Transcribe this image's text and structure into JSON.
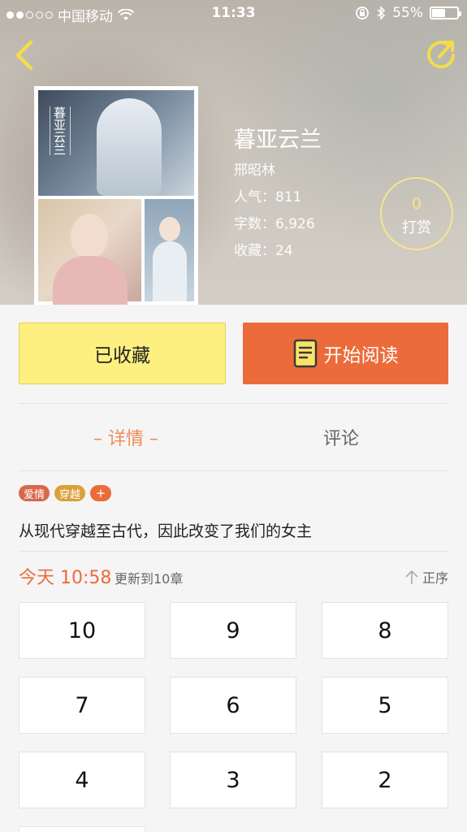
{
  "status_bar": {
    "carrier": "中国移动",
    "time": "11:33",
    "battery": "55%"
  },
  "book": {
    "title": "暮亚云兰",
    "cover_title": "暮亚云兰",
    "author": "邢昭林",
    "popularity": "人气：811",
    "word_count": "字数：6,926",
    "favorites": "收藏：24"
  },
  "tip": {
    "count": "0",
    "label": "打赏"
  },
  "actions": {
    "favorite_label": "已收藏",
    "read_label": "开始阅读"
  },
  "tabs": {
    "detail": "– 详情 –",
    "comments": "评论"
  },
  "tags": [
    "爱情",
    "穿越",
    "+"
  ],
  "description": "从现代穿越至古代，因此改变了我们的女主",
  "update": {
    "time": "今天 10:58",
    "text": "更新到10章",
    "order": "正序"
  },
  "chapters": [
    "10",
    "9",
    "8",
    "7",
    "6",
    "5",
    "4",
    "3",
    "2"
  ],
  "colors": {
    "accent": "#ec6b3a",
    "favorite_bg": "#fdf081",
    "tip_ring": "#f6e58d"
  }
}
